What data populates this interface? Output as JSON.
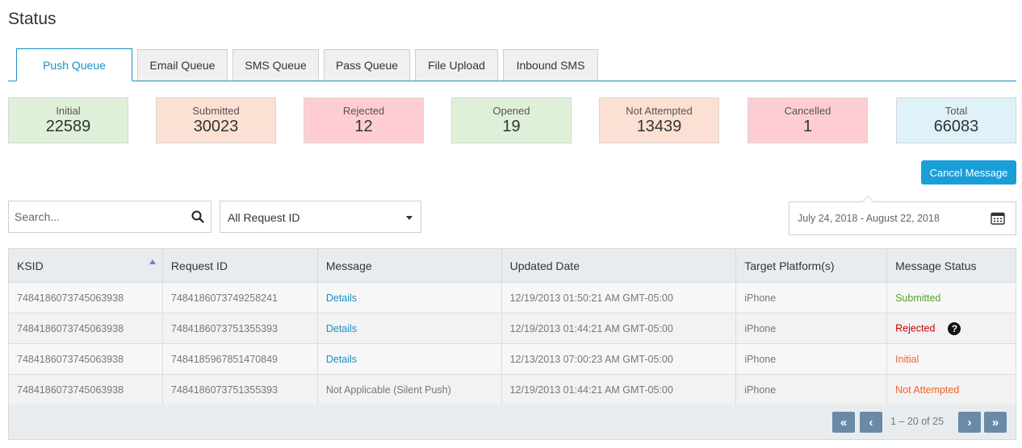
{
  "page": {
    "title": "Status"
  },
  "tabs": [
    {
      "label": "Push  Queue",
      "active": true
    },
    {
      "label": "Email Queue"
    },
    {
      "label": "SMS Queue"
    },
    {
      "label": "Pass Queue"
    },
    {
      "label": "File Upload"
    },
    {
      "label": "Inbound SMS"
    }
  ],
  "stats": [
    {
      "label": "Initial",
      "value": "22589",
      "color": "#dff0d8"
    },
    {
      "label": "Submitted",
      "value": "30023",
      "color": "#fde0d4"
    },
    {
      "label": "Rejected",
      "value": "12",
      "color": "#fdcdd3"
    },
    {
      "label": "Opened",
      "value": "19",
      "color": "#dff0d8"
    },
    {
      "label": "Not Attempted",
      "value": "13439",
      "color": "#fde0d4"
    },
    {
      "label": "Cancelled",
      "value": "1",
      "color": "#fdcdd3"
    },
    {
      "label": "Total",
      "value": "66083",
      "color": "#dff2fa"
    }
  ],
  "actions": {
    "cancel_message": "Cancel Message"
  },
  "filters": {
    "search_placeholder": "Search...",
    "request_select": "All Request ID",
    "date_range": "July 24, 2018 - August 22, 2018"
  },
  "table": {
    "headers": [
      "KSID",
      "Request ID",
      "Message",
      "Updated Date",
      "Target Platform(s)",
      "Message Status"
    ],
    "rows": [
      {
        "ksid": "7484186073745063938",
        "request_id": "7484186073749258241",
        "message": "Details",
        "updated": "12/19/2013 01:50:21 AM GMT-05:00",
        "platform": "iPhone",
        "status": "Submitted"
      },
      {
        "ksid": "7484186073745063938",
        "request_id": "7484186073751355393",
        "message": "Details",
        "updated": "12/19/2013 01:44:21 AM GMT-05:00",
        "platform": "iPhone",
        "status": "Rejected"
      },
      {
        "ksid": "7484186073745063938",
        "request_id": "7484185967851470849",
        "message": "Details",
        "updated": "12/13/2013 07:00:23 AM GMT-05:00",
        "platform": "iPhone",
        "status": "Initial"
      },
      {
        "ksid": "7484186073745063938",
        "request_id": "7484186073751355393",
        "message": "Not Applicable (Silent Push)",
        "updated": "12/19/2013 01:44:21 AM GMT-05:00",
        "platform": "iPhone",
        "status": "Not Attempted"
      }
    ],
    "status_help_icon": "?"
  },
  "pagination": {
    "first": "«",
    "prev": "‹",
    "info": "1 – 20 of 25",
    "next": "›",
    "last": "»"
  },
  "colors": {
    "accent": "#1a8fc2",
    "button": "#1a9ed8",
    "status_submitted": "#5aa02c",
    "status_rejected": "#cc0000",
    "status_initial": "#f0642b",
    "pager_button": "#6a8aa8"
  }
}
